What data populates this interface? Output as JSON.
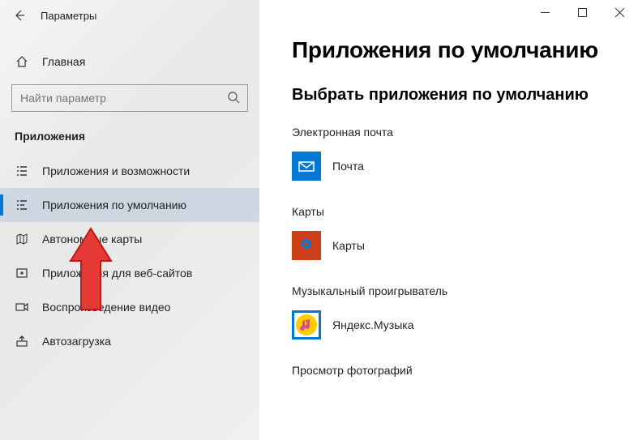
{
  "window": {
    "title": "Параметры"
  },
  "sidebar": {
    "home_label": "Главная",
    "search_placeholder": "Найти параметр",
    "section_label": "Приложения",
    "items": [
      {
        "label": "Приложения и возможности"
      },
      {
        "label": "Приложения по умолчанию"
      },
      {
        "label": "Автономные карты"
      },
      {
        "label": "Приложения для веб-сайтов"
      },
      {
        "label": "Воспроизведение видео"
      },
      {
        "label": "Автозагрузка"
      }
    ]
  },
  "main": {
    "heading": "Приложения по умолчанию",
    "subheading": "Выбрать приложения по умолчанию",
    "categories": [
      {
        "label": "Электронная почта",
        "app": "Почта"
      },
      {
        "label": "Карты",
        "app": "Карты"
      },
      {
        "label": "Музыкальный проигрыватель",
        "app": "Яндекс.Музыка"
      },
      {
        "label": "Просмотр фотографий",
        "app": ""
      }
    ]
  }
}
